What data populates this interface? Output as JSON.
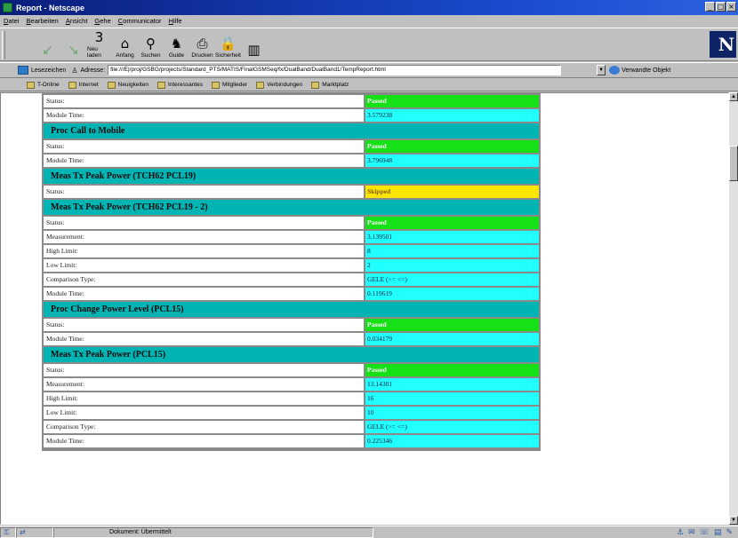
{
  "window": {
    "title": "Report - Netscape"
  },
  "menu": [
    "Datei",
    "Bearbeiten",
    "Ansicht",
    "Gehe",
    "Communicator",
    "Hilfe"
  ],
  "toolbar": {
    "buttons": [
      {
        "label": "",
        "icon": "back-arrow-icon",
        "glyph": "↙"
      },
      {
        "label": "",
        "icon": "forward-arrow-icon",
        "glyph": "↘"
      },
      {
        "label": "Neu laden",
        "icon": "reload-icon",
        "glyph": "3"
      },
      {
        "label": "Anfang",
        "icon": "home-icon",
        "glyph": "⌂"
      },
      {
        "label": "Suchen",
        "icon": "search-icon",
        "glyph": "⚲"
      },
      {
        "label": "Guide",
        "icon": "guide-icon",
        "glyph": "♞"
      },
      {
        "label": "Drucken",
        "icon": "print-icon",
        "glyph": "⎙"
      },
      {
        "label": "Sicherheit",
        "icon": "security-lock-icon",
        "glyph": "🔒"
      },
      {
        "label": "",
        "icon": "stop-icon",
        "glyph": "▥"
      }
    ],
    "logo": "N"
  },
  "location": {
    "bookmarks_label": "Lesezeichen",
    "address_label": "Adresse:",
    "url": "file:///E|/proj/GSBG/projects/Standard_PTS/MATIS/FinalGSMSeq/fx/DualBand/DualBand1/TempReport.html",
    "related_label": "Verwandte Objekt"
  },
  "personal_toolbar": [
    "T-Online",
    "Internet",
    "Neuigkeiten",
    "Interessantes",
    "Mitglieder",
    "Verbindungen",
    "Marktplatz"
  ],
  "report": {
    "sections": [
      {
        "title": "",
        "rows": [
          {
            "key": "Status:",
            "value": "Passed",
            "kind": "passed"
          },
          {
            "key": "Module Time:",
            "value": "3.579238",
            "kind": ""
          }
        ]
      },
      {
        "title": "Proc Call to Mobile",
        "rows": [
          {
            "key": "Status:",
            "value": "Passed",
            "kind": "passed"
          },
          {
            "key": "Module Time:",
            "value": "3.796948",
            "kind": ""
          }
        ]
      },
      {
        "title": "Meas Tx Peak Power (TCH62 PCL19)",
        "rows": [
          {
            "key": "Status:",
            "value": "Skipped",
            "kind": "skipped"
          }
        ]
      },
      {
        "title": "Meas Tx Peak Power (TCH62 PCL19 - 2)",
        "rows": [
          {
            "key": "Status:",
            "value": "Passed",
            "kind": "passed"
          },
          {
            "key": "Measurement:",
            "value": "3.139501",
            "kind": ""
          },
          {
            "key": "High Limit:",
            "value": "8",
            "kind": ""
          },
          {
            "key": "Low Limit:",
            "value": "2",
            "kind": ""
          },
          {
            "key": "Comparison Type:",
            "value": "GELE (>= <=)",
            "kind": ""
          },
          {
            "key": "Module Time:",
            "value": "0.119619",
            "kind": ""
          }
        ]
      },
      {
        "title": "Proc Change Power Level (PCL15)",
        "rows": [
          {
            "key": "Status:",
            "value": "Passed",
            "kind": "passed"
          },
          {
            "key": "Module Time:",
            "value": "0.034179",
            "kind": ""
          }
        ]
      },
      {
        "title": "Meas Tx Peak Power (PCL15)",
        "rows": [
          {
            "key": "Status:",
            "value": "Passed",
            "kind": "passed"
          },
          {
            "key": "Measurement:",
            "value": "13.14301",
            "kind": ""
          },
          {
            "key": "High Limit:",
            "value": "16",
            "kind": ""
          },
          {
            "key": "Low Limit:",
            "value": "10",
            "kind": ""
          },
          {
            "key": "Comparison Type:",
            "value": "GELE (>= <=)",
            "kind": ""
          },
          {
            "key": "Module Time:",
            "value": "0.225346",
            "kind": ""
          }
        ]
      }
    ]
  },
  "status": {
    "text": "Dokument: Übermittelt"
  },
  "colors": {
    "section_header": "#00b4b4",
    "value_cell": "#22ffff",
    "passed": "#16e016",
    "skipped": "#ffe600"
  }
}
